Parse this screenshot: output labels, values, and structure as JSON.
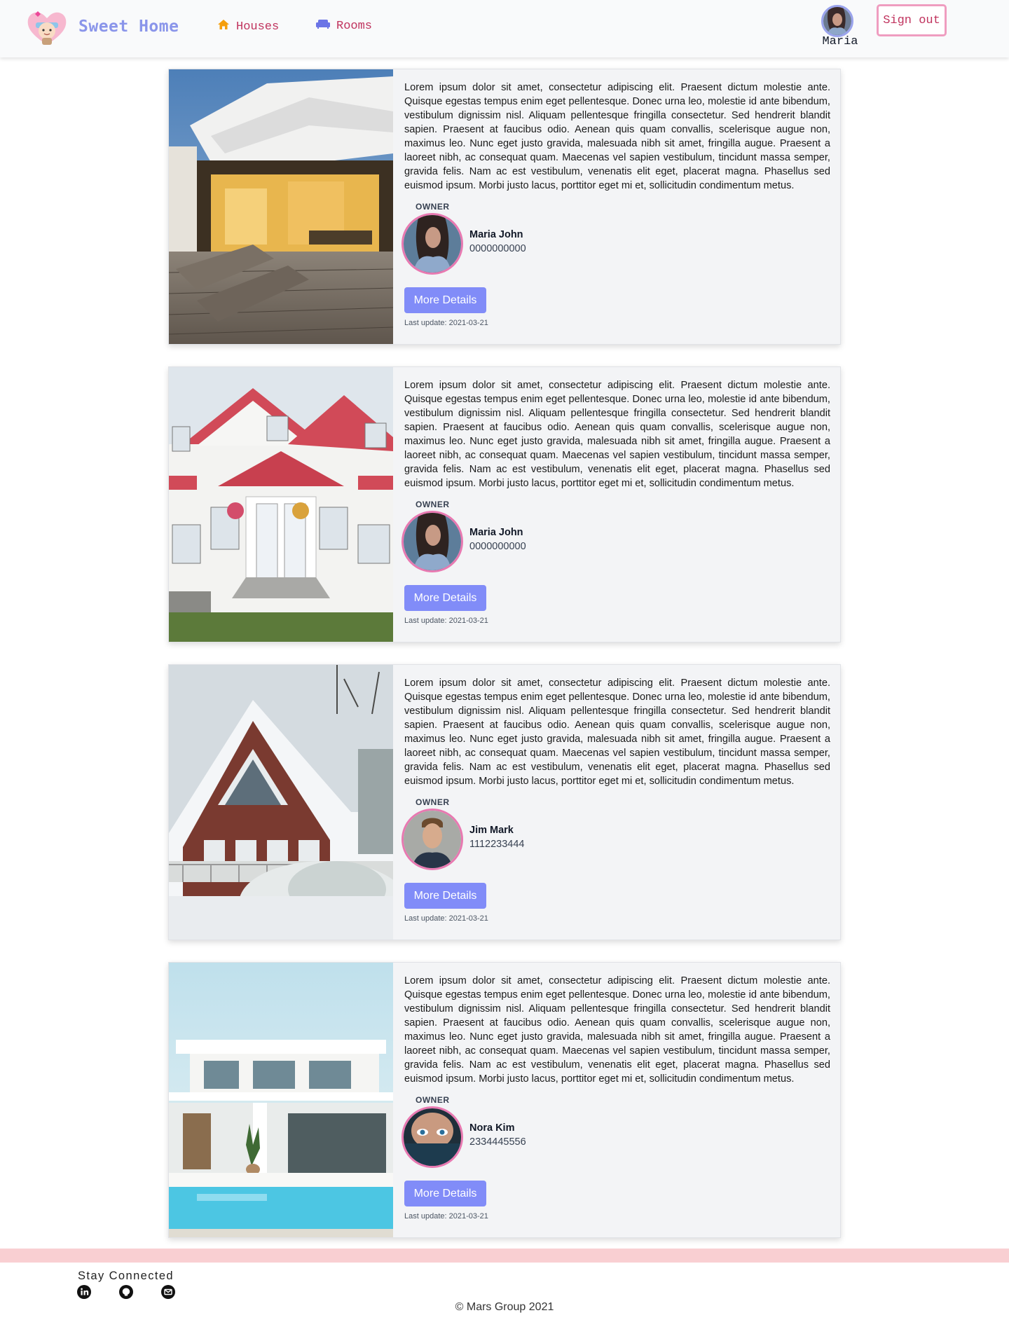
{
  "nav": {
    "brand": "Sweet Home",
    "links": [
      {
        "label": "Houses",
        "icon": "house-icon",
        "color": "#f59e0b"
      },
      {
        "label": "Rooms",
        "icon": "sofa-icon",
        "color": "#6b74e6"
      }
    ],
    "user_name": "Maria",
    "signout_label": "Sign out"
  },
  "listings": [
    {
      "image": "modern-house-deck-photo",
      "description": "Lorem ipsum dolor sit amet, consectetur adipiscing elit. Praesent dictum molestie ante. Quisque egestas tempus enim eget pellentesque. Donec urna leo, molestie id ante bibendum, vestibulum dignissim nisl. Aliquam pellentesque fringilla consectetur. Sed hendrerit blandit sapien. Praesent at faucibus odio. Aenean quis quam convallis, scelerisque augue non, maximus leo. Nunc eget justo gravida, malesuada nibh sit amet, fringilla augue. Praesent a laoreet nibh, ac consequat quam. Maecenas vel sapien vestibulum, tincidunt massa semper, gravida felis. Nam ac est vestibulum, venenatis elit eget, placerat magna. Phasellus sed euismod ipsum. Morbi justo lacus, porttitor eget mi et, sollicitudin condimentum metus.",
      "owner_label": "OWNER",
      "owner_name": "Maria John",
      "owner_phone": "0000000000",
      "button_label": "More Details",
      "last_update": "Last update: 2021-03-21"
    },
    {
      "image": "white-cottage-red-roof-photo",
      "description": "Lorem ipsum dolor sit amet, consectetur adipiscing elit. Praesent dictum molestie ante. Quisque egestas tempus enim eget pellentesque. Donec urna leo, molestie id ante bibendum, vestibulum dignissim nisl. Aliquam pellentesque fringilla consectetur. Sed hendrerit blandit sapien. Praesent at faucibus odio. Aenean quis quam convallis, scelerisque augue non, maximus leo. Nunc eget justo gravida, malesuada nibh sit amet, fringilla augue. Praesent a laoreet nibh, ac consequat quam. Maecenas vel sapien vestibulum, tincidunt massa semper, gravida felis. Nam ac est vestibulum, venenatis elit eget, placerat magna. Phasellus sed euismod ipsum. Morbi justo lacus, porttitor eget mi et, sollicitudin condimentum metus.",
      "owner_label": "OWNER",
      "owner_name": "Maria John",
      "owner_phone": "0000000000",
      "button_label": "More Details",
      "last_update": "Last update: 2021-03-21"
    },
    {
      "image": "snowy-aframe-house-photo",
      "description": "Lorem ipsum dolor sit amet, consectetur adipiscing elit. Praesent dictum molestie ante. Quisque egestas tempus enim eget pellentesque. Donec urna leo, molestie id ante bibendum, vestibulum dignissim nisl. Aliquam pellentesque fringilla consectetur. Sed hendrerit blandit sapien. Praesent at faucibus odio. Aenean quis quam convallis, scelerisque augue non, maximus leo. Nunc eget justo gravida, malesuada nibh sit amet, fringilla augue. Praesent a laoreet nibh, ac consequat quam. Maecenas vel sapien vestibulum, tincidunt massa semper, gravida felis. Nam ac est vestibulum, venenatis elit eget, placerat magna. Phasellus sed euismod ipsum. Morbi justo lacus, porttitor eget mi et, sollicitudin condimentum metus.",
      "owner_label": "OWNER",
      "owner_name": "Jim Mark",
      "owner_phone": "1112233444",
      "button_label": "More Details",
      "last_update": "Last update: 2021-03-21"
    },
    {
      "image": "modern-villa-pool-photo",
      "description": "Lorem ipsum dolor sit amet, consectetur adipiscing elit. Praesent dictum molestie ante. Quisque egestas tempus enim eget pellentesque. Donec urna leo, molestie id ante bibendum, vestibulum dignissim nisl. Aliquam pellentesque fringilla consectetur. Sed hendrerit blandit sapien. Praesent at faucibus odio. Aenean quis quam convallis, scelerisque augue non, maximus leo. Nunc eget justo gravida, malesuada nibh sit amet, fringilla augue. Praesent a laoreet nibh, ac consequat quam. Maecenas vel sapien vestibulum, tincidunt massa semper, gravida felis. Nam ac est vestibulum, venenatis elit eget, placerat magna. Phasellus sed euismod ipsum. Morbi justo lacus, porttitor eget mi et, sollicitudin condimentum metus.",
      "owner_label": "OWNER",
      "owner_name": "Nora Kim",
      "owner_phone": "2334445556",
      "button_label": "More Details",
      "last_update": "Last update: 2021-03-21"
    }
  ],
  "footer": {
    "stay_connected": "Stay Connected",
    "social_icons": [
      "linkedin-icon",
      "github-icon",
      "email-icon"
    ],
    "copyright": "© Mars Group 2021"
  },
  "colors": {
    "brand": "#8a95ea",
    "link": "#c0335e",
    "button": "#818cf8",
    "avatar_ring": "#e879b1",
    "footer_band": "#f9cfd2"
  }
}
